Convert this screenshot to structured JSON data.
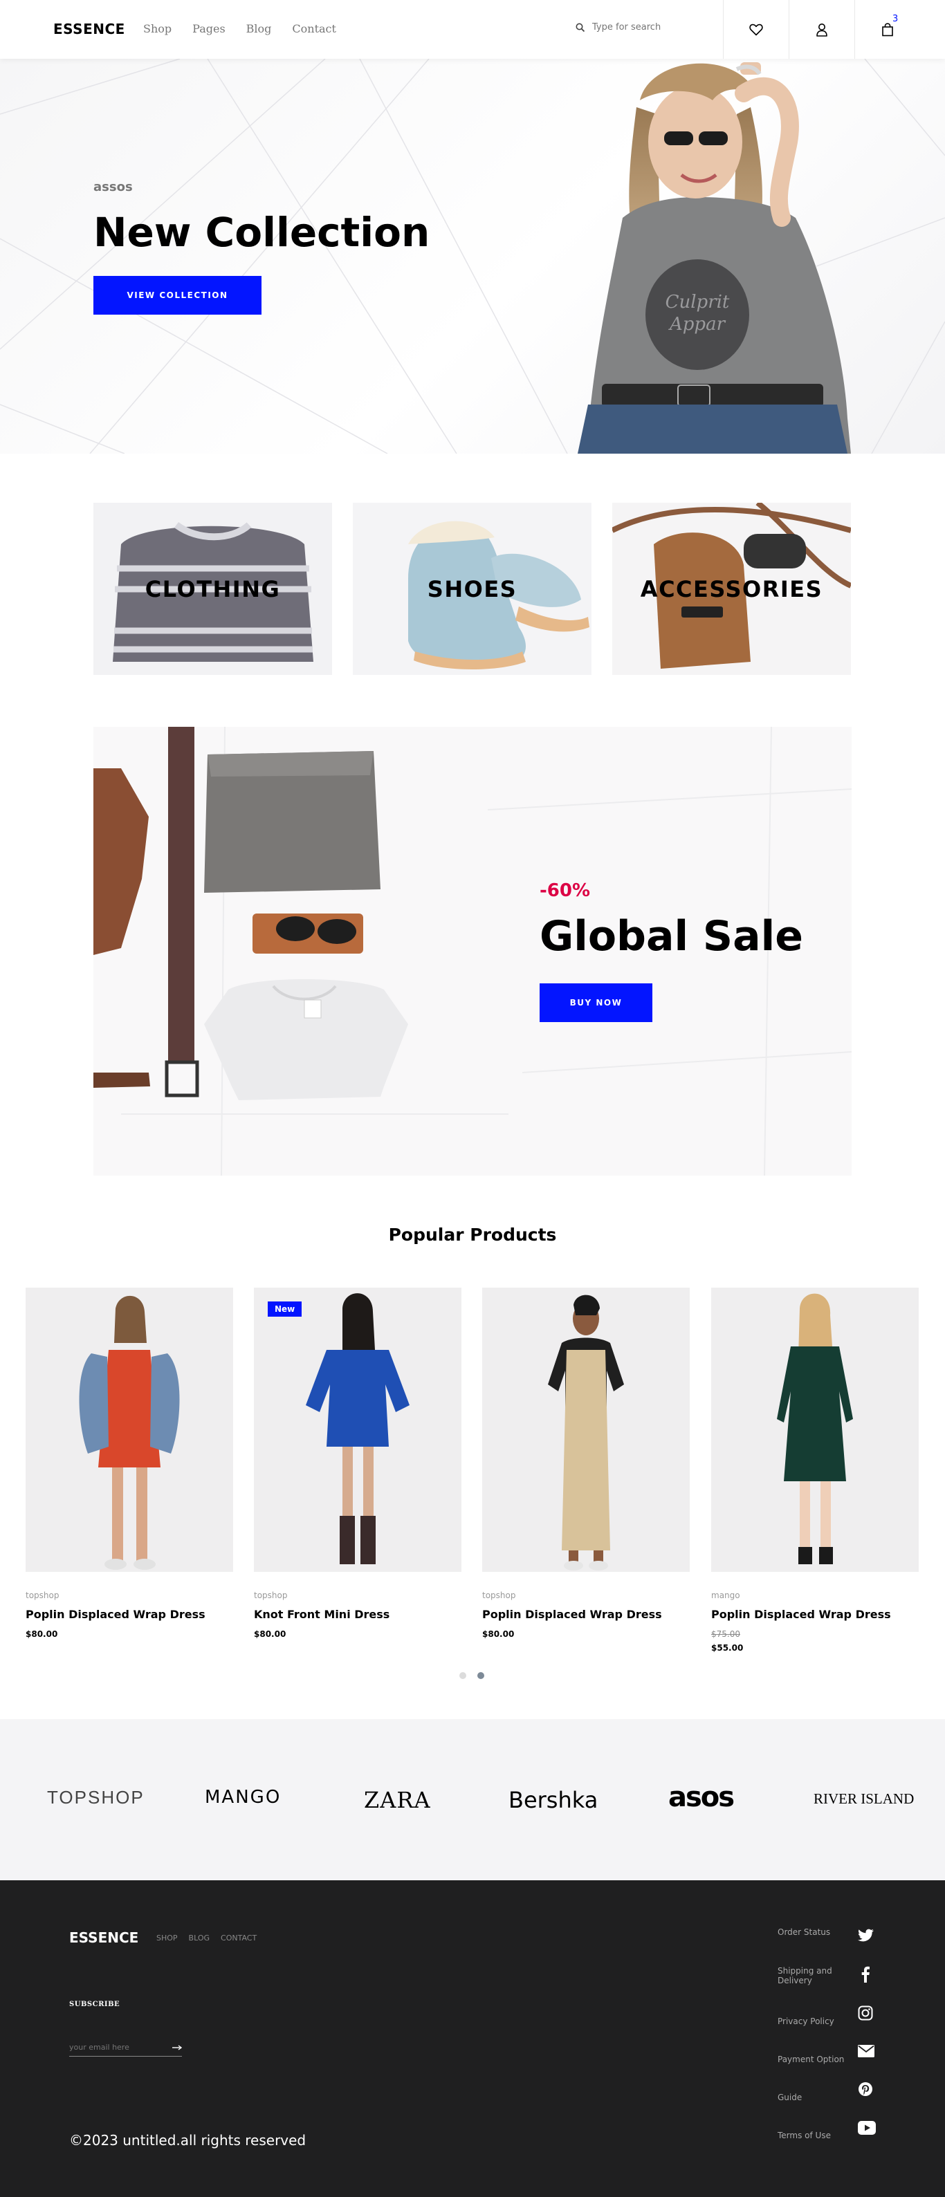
{
  "header": {
    "logo": "ESSENCE",
    "nav": [
      "Shop",
      "Pages",
      "Blog",
      "Contact"
    ],
    "search_placeholder": "Type for search",
    "cart_count": "3"
  },
  "hero": {
    "brand": "assos",
    "title": "New Collection",
    "button": "VIEW COLLECTION"
  },
  "categories": [
    "CLOTHING",
    "SHOES",
    "ACCESSORIES"
  ],
  "sale": {
    "discount": "-60%",
    "title": "Global Sale",
    "button": "BUY NOW"
  },
  "popular": {
    "title": "Popular Products",
    "products": [
      {
        "brand": "topshop",
        "name": "Poplin Displaced Wrap Dress",
        "price": "$80.00",
        "old_price": "",
        "badge": ""
      },
      {
        "brand": "topshop",
        "name": "Knot Front Mini Dress",
        "price": "$80.00",
        "old_price": "",
        "badge": "New"
      },
      {
        "brand": "topshop",
        "name": "Poplin Displaced Wrap Dress",
        "price": "$80.00",
        "old_price": "",
        "badge": ""
      },
      {
        "brand": "mango",
        "name": "Poplin Displaced Wrap Dress",
        "price": "$55.00",
        "old_price": "$75.00",
        "badge": ""
      }
    ],
    "active_page": 2,
    "pages": 2
  },
  "brands": [
    "TOPSHOP",
    "MANGO",
    "ZARA",
    "Bershka",
    "asos",
    "RIVER ISLAND"
  ],
  "footer": {
    "logo": "ESSENCE",
    "nav": [
      "SHOP",
      "BLOG",
      "CONTACT"
    ],
    "subscribe": "SUBSCRIBE",
    "email_placeholder": "your email here",
    "copyright": "©2023 untitled.all rights reserved",
    "links": [
      "Order Status",
      "Shipping and Delivery",
      "Privacy Policy",
      "Payment Option",
      "Guide",
      "Terms of Use"
    ],
    "social_icons": [
      "twitter-icon",
      "facebook-icon",
      "instagram-icon",
      "email-icon",
      "pinterest-icon",
      "youtube-icon"
    ]
  },
  "colors": {
    "accent": "#0315ff",
    "sale_red": "#dc0345",
    "footer_bg": "#1f1f20",
    "brands_bg": "#f4f4f6"
  }
}
